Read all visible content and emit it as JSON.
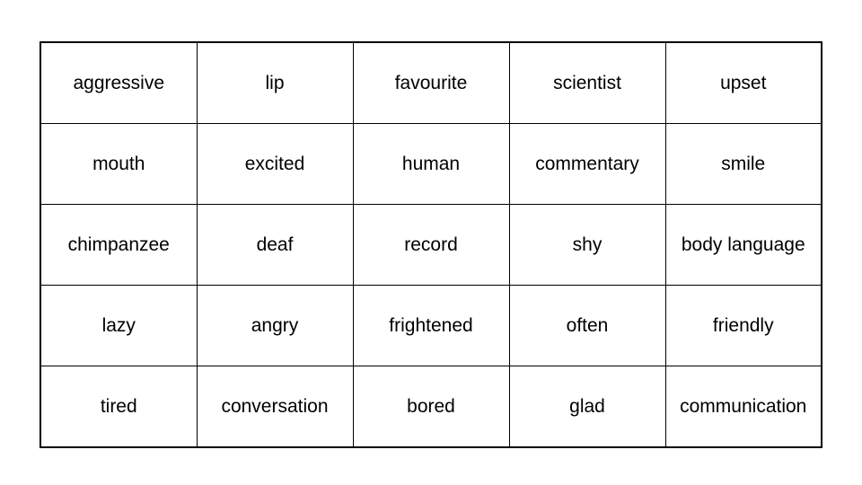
{
  "table": {
    "rows": [
      [
        "aggressive",
        "lip",
        "favourite",
        "scientist",
        "upset"
      ],
      [
        "mouth",
        "excited",
        "human",
        "commentary",
        "smile"
      ],
      [
        "chimpanzee",
        "deaf",
        "record",
        "shy",
        "body language"
      ],
      [
        "lazy",
        "angry",
        "frightened",
        "often",
        "friendly"
      ],
      [
        "tired",
        "conversation",
        "bored",
        "glad",
        "communication"
      ]
    ]
  }
}
